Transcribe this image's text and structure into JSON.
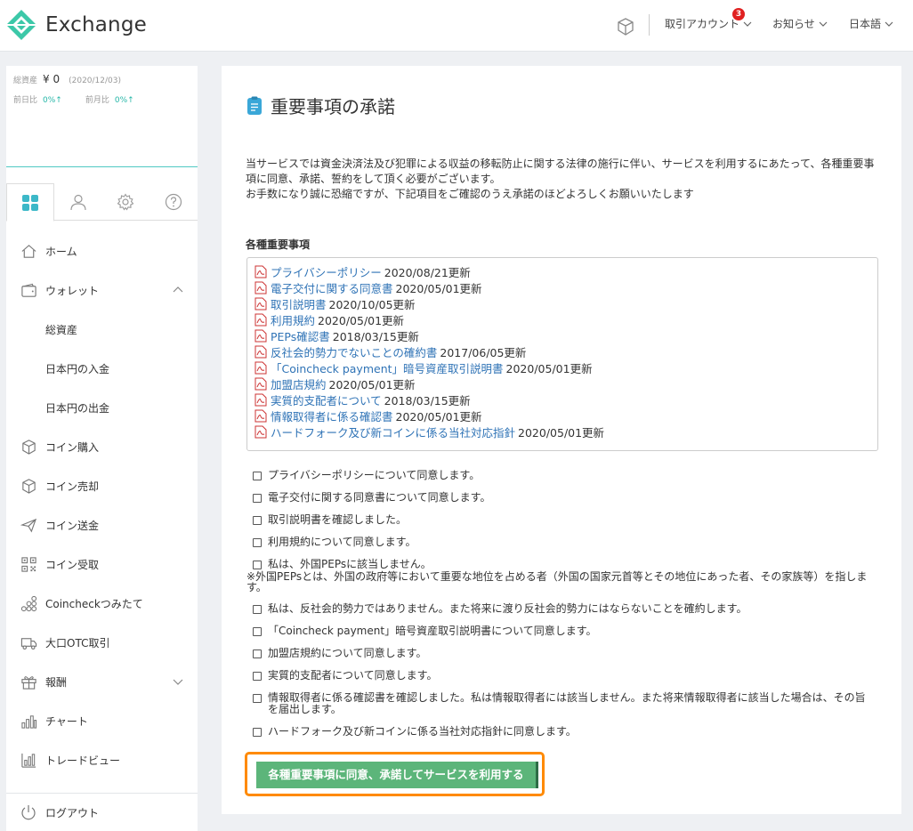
{
  "header": {
    "logo_text": "Exchange",
    "account_label": "取引アカウント",
    "account_badge": "3",
    "notice_label": "お知らせ",
    "language_label": "日本語"
  },
  "sidebar": {
    "assets": {
      "total_label": "総資産",
      "total_value": "¥ 0",
      "date": "(2020/12/03)",
      "day_label": "前日比",
      "day_value": "0%↑",
      "month_label": "前月比",
      "month_value": "0%↑"
    },
    "nav": [
      {
        "label": "ホーム",
        "icon": "home-icon"
      },
      {
        "label": "ウォレット",
        "icon": "wallet-icon"
      },
      {
        "label": "総資産",
        "icon": ""
      },
      {
        "label": "日本円の入金",
        "icon": ""
      },
      {
        "label": "日本円の出金",
        "icon": ""
      },
      {
        "label": "コイン購入",
        "icon": "cube-icon"
      },
      {
        "label": "コイン売却",
        "icon": "cube-icon"
      },
      {
        "label": "コイン送金",
        "icon": "send-icon"
      },
      {
        "label": "コイン受取",
        "icon": "qr-icon"
      },
      {
        "label": "Coincheckつみたて",
        "icon": "coins-icon"
      },
      {
        "label": "大口OTC取引",
        "icon": "truck-icon"
      },
      {
        "label": "報酬",
        "icon": "gift-icon"
      },
      {
        "label": "チャート",
        "icon": "bar-chart-icon"
      },
      {
        "label": "トレードビュー",
        "icon": "trade-view-icon"
      }
    ],
    "logout_label": "ログアウト"
  },
  "main": {
    "title": "重要事項の承諾",
    "intro_1": "当サービスでは資金決済法及び犯罪による収益の移転防止に関する法律の施行に伴い、サービスを利用するにあたって、各種重要事項に同意、承諾、誓約をして頂く必要がございます。",
    "intro_2": "お手数になり誠に恐縮ですが、下記項目をご確認のうえ承諾のほどよろしくお願いいたします",
    "section_heading": "各種重要事項",
    "documents": [
      {
        "title": "プライバシーポリシー",
        "updated": "2020/08/21更新"
      },
      {
        "title": "電子交付に関する同意書",
        "updated": "2020/05/01更新"
      },
      {
        "title": "取引説明書",
        "updated": "2020/10/05更新"
      },
      {
        "title": "利用規約",
        "updated": "2020/05/01更新"
      },
      {
        "title": "PEPs確認書",
        "updated": "2018/03/15更新"
      },
      {
        "title": "反社会的勢力でないことの確約書",
        "updated": "2017/06/05更新"
      },
      {
        "title": "「Coincheck payment」暗号資産取引説明書",
        "updated": "2020/05/01更新"
      },
      {
        "title": "加盟店規約",
        "updated": "2020/05/01更新"
      },
      {
        "title": "実質的支配者について",
        "updated": "2018/03/15更新"
      },
      {
        "title": "情報取得者に係る確認書",
        "updated": "2020/05/01更新"
      },
      {
        "title": "ハードフォーク及び新コインに係る当社対応指針",
        "updated": "2020/05/01更新"
      }
    ],
    "checks": [
      "プライバシーポリシーについて同意します。",
      "電子交付に関する同意書について同意します。",
      "取引説明書を確認しました。",
      "利用規約について同意します。",
      "私は、外国PEPsに該当しません。",
      "私は、反社会的勢力ではありません。また将来に渡り反社会的勢力にはならないことを確約します。",
      "「Coincheck payment」暗号資産取引説明書について同意します。",
      "加盟店規約について同意します。",
      "実質的支配者について同意します。",
      "情報取得者に係る確認書を確認しました。私は情報取得者には該当しません。また将来情報取得者に該当した場合は、その旨を届出します。",
      "ハードフォーク及び新コインに係る当社対応指針に同意します。"
    ],
    "peps_note": "※外国PEPsとは、外国の政府等において重要な地位を占める者（外国の国家元首等とその地位にあった者、その家族等）を指します。",
    "submit_label": "各種重要事項に同意、承諾してサービスを利用する"
  }
}
